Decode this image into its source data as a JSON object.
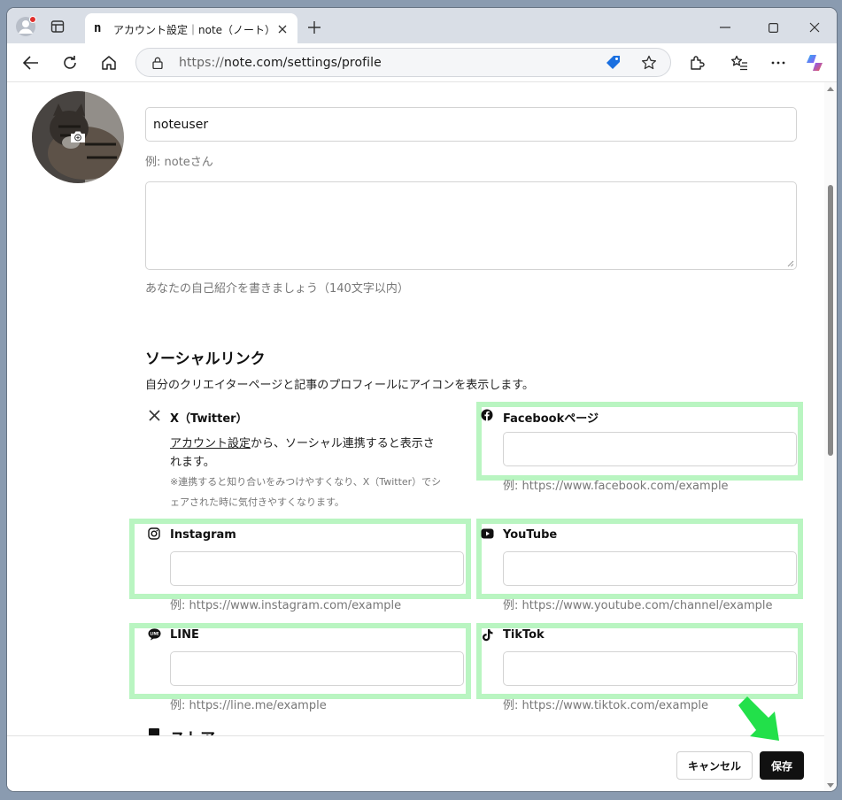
{
  "browser": {
    "tab_title": "アカウント設定｜note（ノート）",
    "tab_favicon": "n",
    "url_scheme": "https://",
    "url_rest": "note.com/settings/profile"
  },
  "profile": {
    "name_value": "noteuser",
    "name_hint": "例: noteさん",
    "bio_value": "",
    "bio_hint": "あなたの自己紹介を書きましょう（140文字以内）"
  },
  "social": {
    "heading": "ソーシャルリンク",
    "description": "自分のクリエイターページと記事のプロフィールにアイコンを表示します。",
    "x": {
      "label": "X（Twitter）",
      "link_text": "アカウント設定",
      "text_line1": "から、ソーシャル連携すると表示さ",
      "text_line2": "れます。",
      "note_line1": "※連携すると知り合いをみつけやすくなり、X（Twitter）でシ",
      "note_line2": "ェアされた時に気付きやすくなります。"
    },
    "facebook": {
      "label": "Facebookページ",
      "value": "",
      "hint": "例: https://www.facebook.com/example"
    },
    "instagram": {
      "label": "Instagram",
      "value": "",
      "hint": "例: https://www.instagram.com/example"
    },
    "youtube": {
      "label": "YouTube",
      "value": "",
      "hint": "例: https://www.youtube.com/channel/example"
    },
    "line": {
      "label": "LINE",
      "value": "",
      "hint": "例: https://line.me/example"
    },
    "tiktok": {
      "label": "TikTok",
      "value": "",
      "hint": "例: https://www.tiktok.com/example"
    }
  },
  "store": {
    "heading": "ストア"
  },
  "footer": {
    "cancel_label": "キャンセル",
    "save_label": "保存"
  },
  "colors": {
    "highlight": "#b9f5c1",
    "arrow": "#22e04a",
    "save_bg": "#111111"
  }
}
